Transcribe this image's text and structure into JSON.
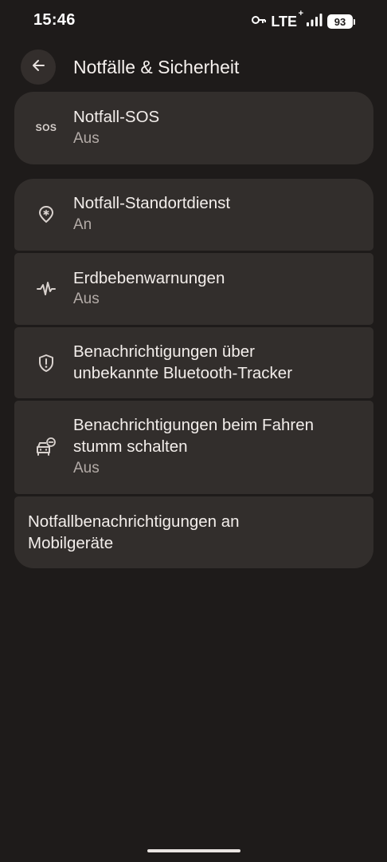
{
  "status_bar": {
    "time": "15:46",
    "network": "LTE",
    "network_plus": "+",
    "battery": "93"
  },
  "header": {
    "title": "Notfälle & Sicherheit"
  },
  "items": [
    {
      "title": "Notfall-SOS",
      "subtitle": "Aus",
      "icon": "sos-icon",
      "icon_text": "SOS"
    },
    {
      "title": "Notfall-Standortdienst",
      "subtitle": "An",
      "icon": "location-asterisk-icon"
    },
    {
      "title": "Erdbebenwarnungen",
      "subtitle": "Aus",
      "icon": "seismic-wave-icon"
    },
    {
      "title": "Benachrichtigungen über unbekannte Bluetooth-Tracker",
      "title_line1": "Benachrichtigungen über",
      "title_line2": "unbekannte Bluetooth-Tracker",
      "icon": "shield-alert-icon"
    },
    {
      "title": "Benachrichtigungen beim Fahren stumm schalten",
      "title_line1": "Benachrichtigungen beim Fahren",
      "title_line2": "stumm schalten",
      "subtitle": "Aus",
      "icon": "car-mute-icon"
    },
    {
      "title": "Notfallbenachrichtigungen an Mobilgeräte",
      "title_line1": "Notfallbenachrichtigungen an",
      "title_line2": "Mobilgeräte"
    }
  ],
  "colors": {
    "background": "#1e1b1a",
    "card": "#322e2c",
    "text_primary": "#f3eeeb",
    "text_secondary": "#b3aba7"
  }
}
